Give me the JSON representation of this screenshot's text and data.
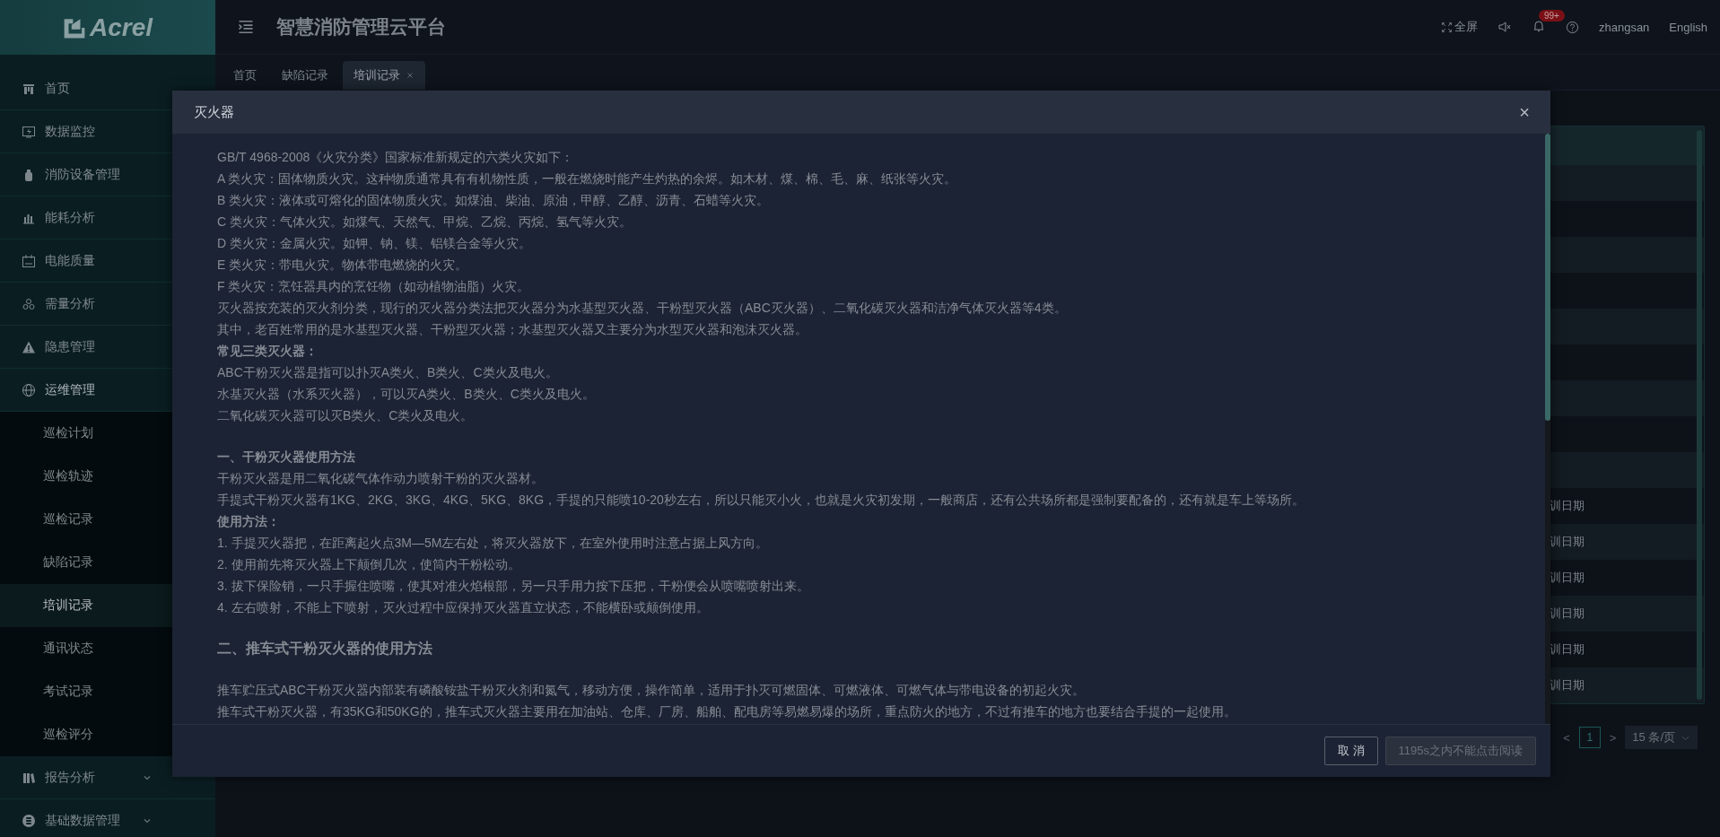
{
  "sidebar": {
    "logo": "Acrel",
    "items": [
      {
        "label": "首页"
      },
      {
        "label": "数据监控"
      },
      {
        "label": "消防设备管理"
      },
      {
        "label": "能耗分析"
      },
      {
        "label": "电能质量"
      },
      {
        "label": "需量分析"
      },
      {
        "label": "隐患管理"
      },
      {
        "label": "运维管理",
        "expanded": true,
        "children": [
          {
            "label": "巡检计划",
            "selected": false
          },
          {
            "label": "巡检轨迹",
            "selected": false
          },
          {
            "label": "巡检记录",
            "selected": false
          },
          {
            "label": "缺陷记录",
            "selected": false
          },
          {
            "label": "培训记录",
            "selected": true
          },
          {
            "label": "通讯状态",
            "selected": false
          },
          {
            "label": "考试记录",
            "selected": false
          },
          {
            "label": "巡检评分",
            "selected": false
          }
        ]
      },
      {
        "label": "报告分析",
        "expanded": false
      },
      {
        "label": "基础数据管理",
        "expanded": false
      }
    ]
  },
  "header": {
    "title": "智慧消防管理云平台",
    "fullscreen": "全屏",
    "badge": "99+",
    "user": "zhangsan",
    "language": "English"
  },
  "tabs": [
    {
      "label": "首页",
      "selected": false,
      "closable": false
    },
    {
      "label": "缺陷记录",
      "selected": false,
      "closable": false
    },
    {
      "label": "培训记录",
      "selected": true,
      "closable": true
    }
  ],
  "table": {
    "rows": [
      {
        "column_last": ""
      },
      {
        "column_last": ""
      },
      {
        "column_last": ""
      },
      {
        "column_last": ""
      },
      {
        "column_last": ""
      },
      {
        "column_last": ""
      },
      {
        "column_last": ""
      },
      {
        "column_last": ""
      },
      {
        "column_last": ""
      },
      {
        "column_last": "训日期"
      },
      {
        "column_last": "训日期"
      },
      {
        "column_last": "训日期"
      },
      {
        "column_last": "训日期"
      },
      {
        "column_last": "训日期"
      },
      {
        "column_last": "训日期"
      }
    ]
  },
  "pagination": {
    "prev": "<",
    "page": "1",
    "next": ">",
    "page_size": "15 条/页"
  },
  "modal": {
    "title": "灭火器",
    "close": "×",
    "lines": [
      {
        "kind": "text",
        "text": "GB/T 4968-2008《火灾分类》国家标准新规定的六类火灾如下："
      },
      {
        "kind": "text",
        "text": "A 类火灾：固体物质火灾。这种物质通常具有有机物性质，一般在燃烧时能产生灼热的余烬。如木材、煤、棉、毛、麻、纸张等火灾。"
      },
      {
        "kind": "text",
        "text": "B 类火灾：液体或可熔化的固体物质火灾。如煤油、柴油、原油，甲醇、乙醇、沥青、石蜡等火灾。"
      },
      {
        "kind": "text",
        "text": "C 类火灾：气体火灾。如煤气、天然气、甲烷、乙烷、丙烷、氢气等火灾。"
      },
      {
        "kind": "text",
        "text": "D 类火灾：金属火灾。如钾、钠、镁、铝镁合金等火灾。"
      },
      {
        "kind": "text",
        "text": "E 类火灾：带电火灾。物体带电燃烧的火灾。"
      },
      {
        "kind": "text",
        "text": "F 类火灾：烹饪器具内的烹饪物（如动植物油脂）火灾。"
      },
      {
        "kind": "text",
        "text": "灭火器按充装的灭火剂分类，现行的灭火器分类法把灭火器分为水基型灭火器、干粉型灭火器（ABC灭火器）、二氧化碳灭火器和洁净气体灭火器等4类。"
      },
      {
        "kind": "text",
        "text": "其中，老百姓常用的是水基型灭火器、干粉型灭火器；水基型灭火器又主要分为水型灭火器和泡沫灭火器。"
      },
      {
        "kind": "bold",
        "text": "常见三类灭火器："
      },
      {
        "kind": "text",
        "text": "ABC干粉灭火器是指可以扑灭A类火、B类火、C类火及电火。"
      },
      {
        "kind": "text",
        "text": "水基灭火器（水系灭火器），可以灭A类火、B类火、C类火及电火。"
      },
      {
        "kind": "text",
        "text": "二氧化碳灭火器可以灭B类火、C类火及电火。"
      },
      {
        "kind": "section",
        "text": "一、干粉灭火器使用方法"
      },
      {
        "kind": "text",
        "text": "干粉灭火器是用二氧化碳气体作动力喷射干粉的灭火器材。"
      },
      {
        "kind": "text",
        "text": "手提式干粉灭火器有1KG、2KG、3KG、4KG、5KG、8KG，手提的只能喷10-20秒左右，所以只能灭小火，也就是火灾初发期，一般商店，还有公共场所都是强制要配备的，还有就是车上等场所。"
      },
      {
        "kind": "bold",
        "text": "使用方法："
      },
      {
        "kind": "text",
        "text": "1. 手提灭火器把，在距离起火点3M—5M左右处，将灭火器放下，在室外使用时注意占据上风方向。"
      },
      {
        "kind": "text",
        "text": "2. 使用前先将灭火器上下颠倒几次，使筒内干粉松动。"
      },
      {
        "kind": "text",
        "text": "3. 拔下保险销，一只手握住喷嘴，使其对准火焰根部，另一只手用力按下压把，干粉便会从喷嘴喷射出来。"
      },
      {
        "kind": "text",
        "text": "4. 左右喷射，不能上下喷射，灭火过程中应保持灭火器直立状态，不能横卧或颠倒使用。"
      },
      {
        "kind": "heading",
        "text": "二、推车式干粉灭火器的使用方法"
      },
      {
        "kind": "section-text",
        "text": "推车贮压式ABC干粉灭火器内部装有磷酸铵盐干粉灭火剂和氮气，移动方便，操作简单，适用于扑灭可燃固体、可燃液体、可燃气体与带电设备的初起火灾。"
      },
      {
        "kind": "text",
        "text": "推车式干粉灭火器，有35KG和50KG的，推车式灭火器主要用在加油站、仓库、厂房、船舶、配电房等易燃易爆的场所，重点防火的地方，不过有推车的地方也要结合手提的一起使用。"
      }
    ],
    "buttons": [
      {
        "label": "取 消",
        "disabled": false
      },
      {
        "label": "1195s之内不能点击阅读",
        "disabled": true
      }
    ]
  }
}
